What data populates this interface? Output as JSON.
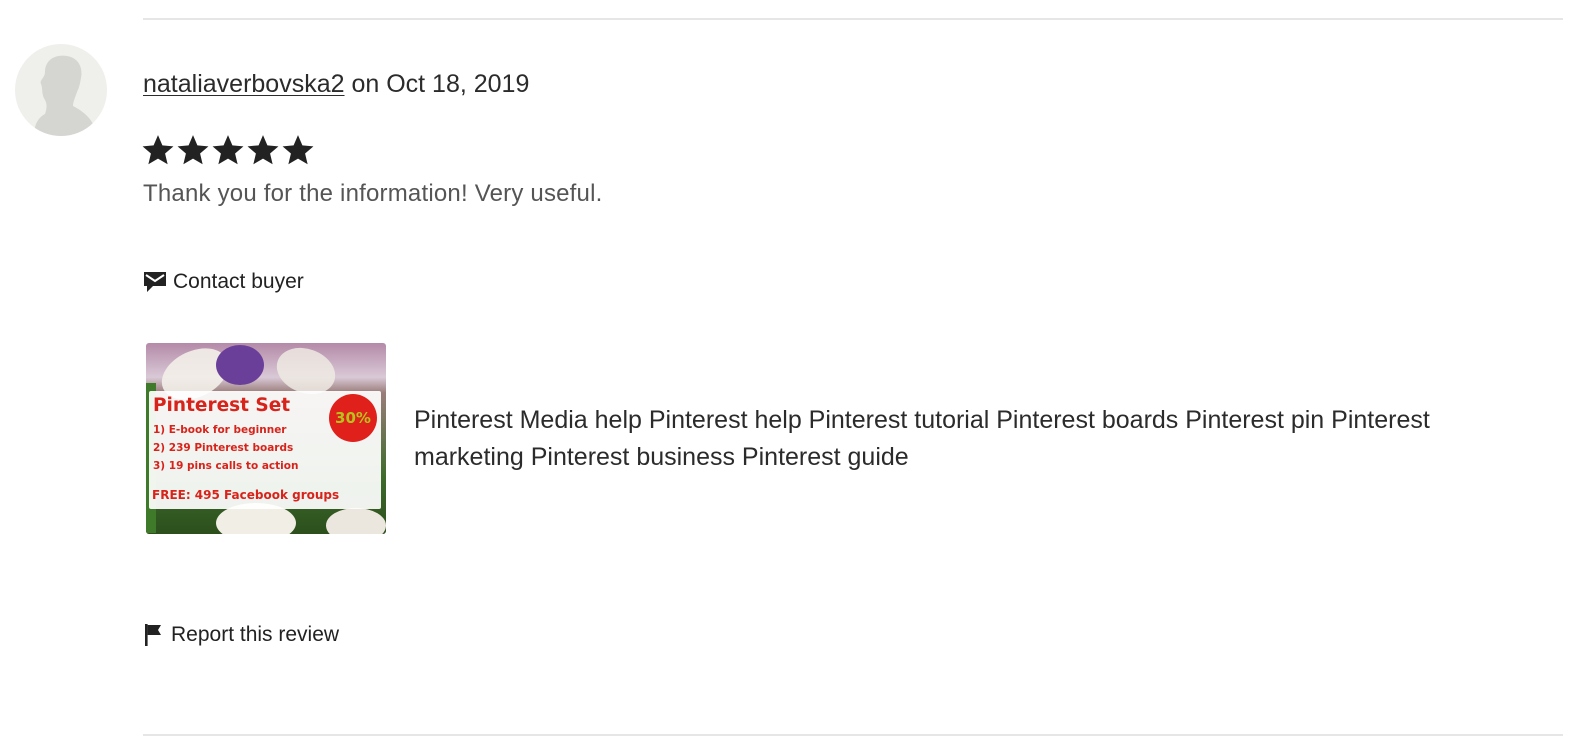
{
  "review": {
    "username": "nataliaverbovska2",
    "date_text": " on Oct 18, 2019",
    "rating": 5,
    "max_rating": 5,
    "text": "Thank you for the information! Very useful.",
    "contact_label": "Contact buyer",
    "report_label": "Report this review"
  },
  "listing": {
    "title": "Pinterest Media help Pinterest help Pinterest tutorial Pinterest boards Pinterest pin Pinterest marketing Pinterest business Pinterest guide",
    "image": {
      "heading": "Pinterest Set",
      "line1": "1) E-book for beginner",
      "line2": "2) 239 Pinterest boards",
      "line3": "3) 19 pins calls to action",
      "free": "FREE: 495 Facebook groups",
      "badge": "30%"
    }
  },
  "icons": {
    "avatar": "default-avatar-icon",
    "star": "star-icon",
    "contact": "message-icon",
    "report": "flag-icon"
  },
  "colors": {
    "text": "#222222",
    "muted_text": "#555555",
    "divider": "#e6e6e6",
    "promo_red": "#d8231b"
  }
}
